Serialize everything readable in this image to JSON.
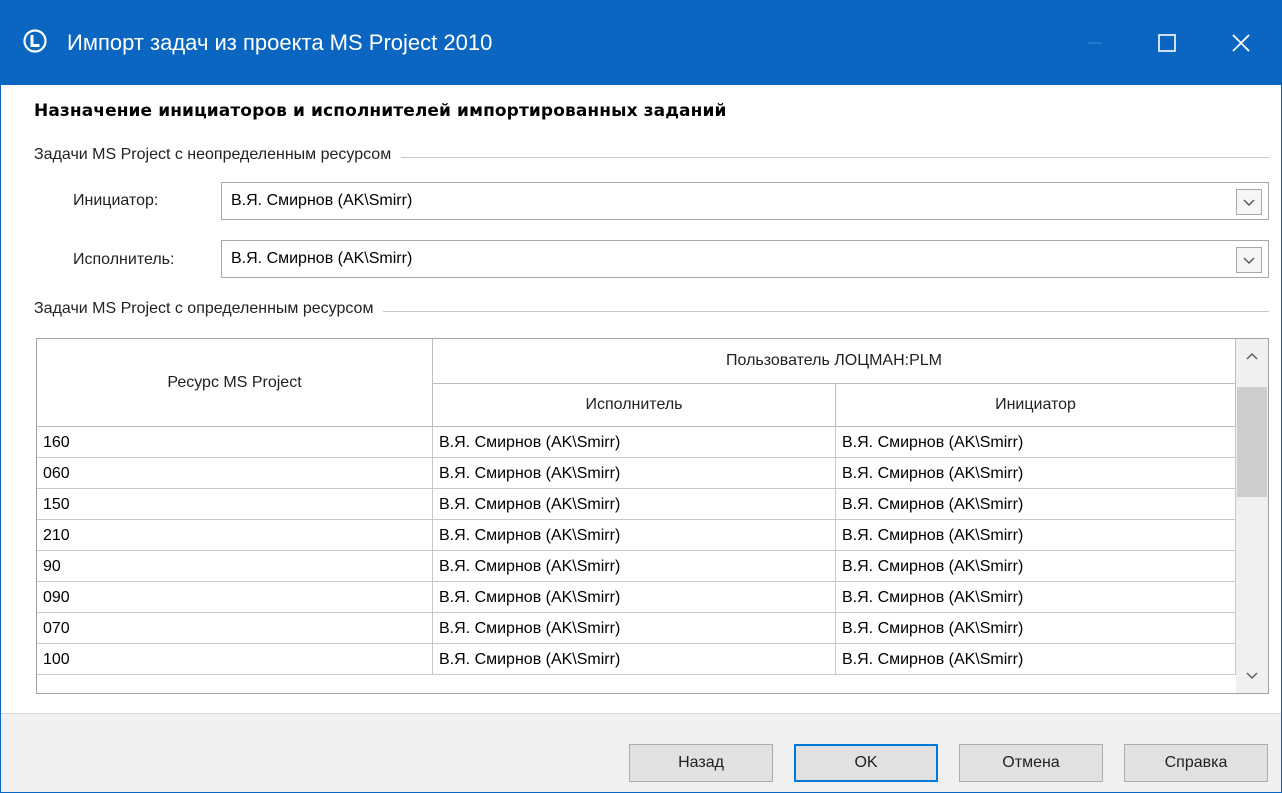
{
  "window": {
    "title": "Импорт задач из проекта MS Project 2010",
    "accent_color": "#0b66c2",
    "controls": [
      "minimize-icon",
      "maximize-icon",
      "close-icon"
    ]
  },
  "heading": "Назначение инициаторов и исполнителей импортированных заданий",
  "undefined_group": {
    "label": "Задачи MS Project с неопределенным ресурсом",
    "initiator_label": "Инициатор:",
    "initiator_value": "В.Я. Смирнов (AK\\Smirr)",
    "executor_label": "Исполнитель:",
    "executor_value": "В.Я. Смирнов (AK\\Smirr)"
  },
  "defined_group": {
    "label": "Задачи MS Project с определенным ресурсом"
  },
  "grid": {
    "col_resource": "Ресурс MS Project",
    "col_user_group": "Пользователь ЛОЦМАН:PLM",
    "col_executor": "Исполнитель",
    "col_initiator": "Инициатор",
    "rows": [
      {
        "resource": "160",
        "executor": "В.Я. Смирнов (AK\\Smirr)",
        "initiator": "В.Я. Смирнов (AK\\Smirr)"
      },
      {
        "resource": "060",
        "executor": "В.Я. Смирнов (AK\\Smirr)",
        "initiator": "В.Я. Смирнов (AK\\Smirr)"
      },
      {
        "resource": "150",
        "executor": "В.Я. Смирнов (AK\\Smirr)",
        "initiator": "В.Я. Смирнов (AK\\Smirr)"
      },
      {
        "resource": "210",
        "executor": "В.Я. Смирнов (AK\\Smirr)",
        "initiator": "В.Я. Смирнов (AK\\Smirr)"
      },
      {
        "resource": "90",
        "executor": "В.Я. Смирнов (AK\\Smirr)",
        "initiator": "В.Я. Смирнов (AK\\Smirr)"
      },
      {
        "resource": "090",
        "executor": "В.Я. Смирнов (AK\\Smirr)",
        "initiator": "В.Я. Смирнов (AK\\Smirr)"
      },
      {
        "resource": "070",
        "executor": "В.Я. Смирнов (AK\\Smirr)",
        "initiator": "В.Я. Смирнов (AK\\Smirr)"
      },
      {
        "resource": "100",
        "executor": "В.Я. Смирнов (AK\\Smirr)",
        "initiator": "В.Я. Смирнов (AK\\Smirr)"
      }
    ]
  },
  "buttons": {
    "back": "Назад",
    "ok": "OK",
    "cancel": "Отмена",
    "help": "Справка"
  }
}
